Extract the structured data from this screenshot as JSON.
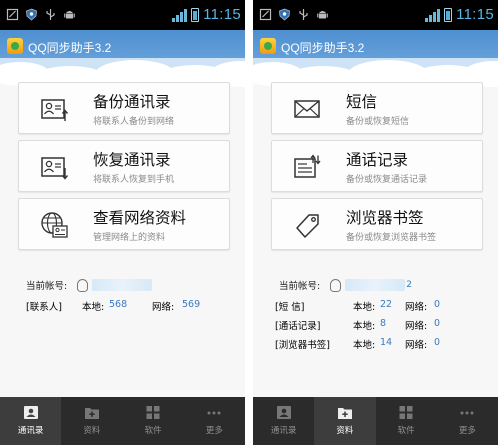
{
  "status_bar": {
    "time": "11:15"
  },
  "app": {
    "title": "QQ同步助手3.2"
  },
  "left_screen": {
    "cards": [
      {
        "title": "备份通讯录",
        "subtitle": "将联系人备份到网络",
        "icon": "contact-card-upload-icon"
      },
      {
        "title": "恢复通讯录",
        "subtitle": "将联系人恢复到手机",
        "icon": "contact-card-download-icon"
      },
      {
        "title": "查看网络资料",
        "subtitle": "管理网络上的资料",
        "icon": "globe-contact-icon"
      }
    ],
    "account_label": "当前帐号:",
    "rows": [
      {
        "label": "[联系人]",
        "local_label": "本地:",
        "local": "568",
        "net_label": "网络:",
        "net": "569"
      }
    ],
    "nav": [
      {
        "label": "通讯录",
        "active": true
      },
      {
        "label": "资料",
        "active": false
      },
      {
        "label": "软件",
        "active": false
      },
      {
        "label": "更多",
        "active": false
      }
    ]
  },
  "right_screen": {
    "cards": [
      {
        "title": "短信",
        "subtitle": "备份或恢复短信",
        "icon": "envelope-icon"
      },
      {
        "title": "通话记录",
        "subtitle": "备份或恢复通话记录",
        "icon": "call-log-icon"
      },
      {
        "title": "浏览器书签",
        "subtitle": "备份或恢复浏览器书签",
        "icon": "bookmark-tag-icon"
      }
    ],
    "account_label": "当前帐号:",
    "account_suffix": "2",
    "rows": [
      {
        "label": "[短   信]",
        "local_label": "本地:",
        "local": "22",
        "net_label": "网络:",
        "net": "0"
      },
      {
        "label": "[通话记录]",
        "local_label": "本地:",
        "local": "8",
        "net_label": "网络:",
        "net": "0"
      },
      {
        "label": "[浏览器书签]",
        "local_label": "本地:",
        "local": "14",
        "net_label": "网络:",
        "net": "0"
      }
    ],
    "nav": [
      {
        "label": "通讯录",
        "active": false
      },
      {
        "label": "资料",
        "active": true
      },
      {
        "label": "软件",
        "active": false
      },
      {
        "label": "更多",
        "active": false
      }
    ]
  },
  "colors": {
    "header": "#5b9bd5",
    "accent": "#3a7bbf",
    "nav_bg": "#2b2b2b"
  }
}
